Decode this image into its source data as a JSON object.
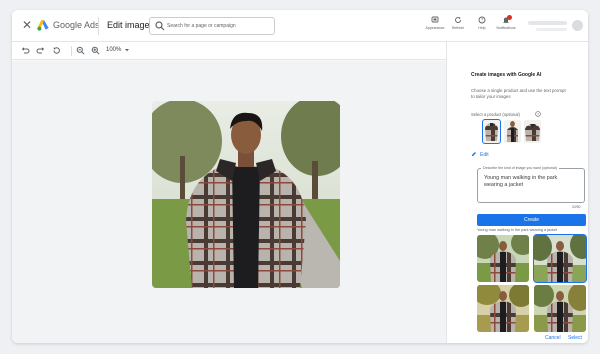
{
  "header": {
    "brand": "Google Ads",
    "page_title": "Edit image",
    "close_icon": "close-icon",
    "search_placeholder": "Search for a page or campaign",
    "actions": [
      {
        "label": "Appearance",
        "icon": "appearance-icon"
      },
      {
        "label": "Refresh",
        "icon": "refresh-icon"
      },
      {
        "label": "Help",
        "icon": "help-icon"
      },
      {
        "label": "Notifications",
        "icon": "notifications-icon"
      }
    ]
  },
  "toolbar": {
    "zoom": "100%",
    "icons": [
      "undo-icon",
      "redo-icon",
      "history-icon",
      "zoom-out-icon",
      "zoom-in-icon",
      "chevron-down-icon"
    ]
  },
  "canvas": {
    "image": "man-in-plaid-jacket-photo"
  },
  "panel": {
    "title": "Create images with Google AI",
    "description": "Choose a single product and use the text prompt to tailor your images",
    "select_label": "Select a product (optional)",
    "edit_label": "Edit",
    "prompt_label": "Describe the kind of image you want (optional)",
    "prompt_value": "Young man walking in the park wearing a jacket",
    "char_count": "0/250",
    "create_label": "Create",
    "result_caption": "Young man walking in the park wearing a jacket",
    "cancel_label": "Cancel",
    "select_label_btn": "Select"
  },
  "colors": {
    "accent": "#1a73e8",
    "notification_dot": "#d93025",
    "logo_blue": "#4285f4",
    "logo_yellow": "#fbbc04",
    "logo_green": "#34a853"
  }
}
